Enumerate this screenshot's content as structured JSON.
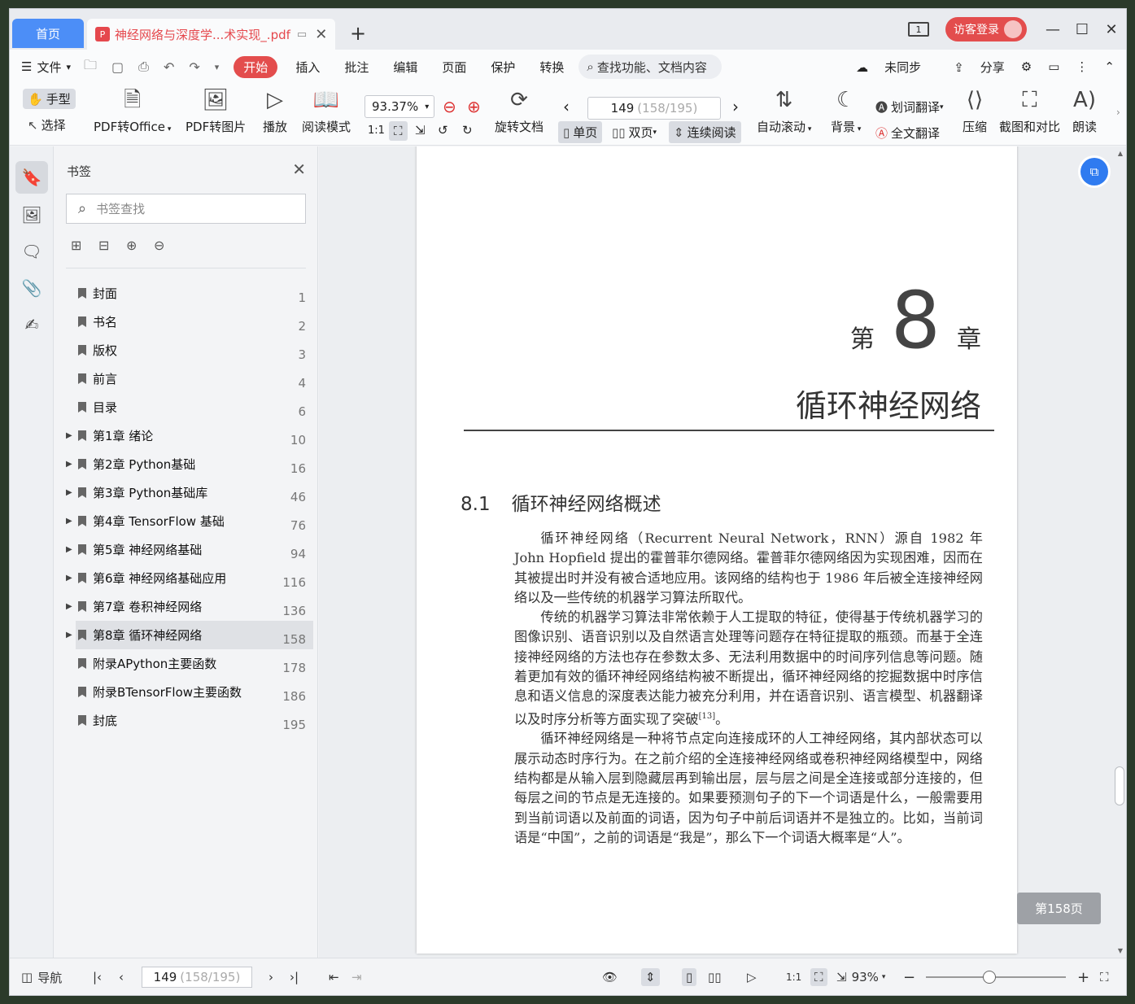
{
  "tabs": {
    "home": "首页",
    "doc_title": "神经网络与深度学...术实现_.pdf",
    "pdf_badge": "P",
    "add": "+"
  },
  "window": {
    "page_count_icon": "1",
    "guest_login": "访客登录",
    "minimize": "—",
    "maximize": "☐",
    "close": "✕"
  },
  "menu": {
    "file": "文件",
    "items": [
      "开始",
      "插入",
      "批注",
      "编辑",
      "页面",
      "保护",
      "转换"
    ],
    "search": "查找功能、文档内容",
    "sync": "未同步",
    "share": "分享"
  },
  "ribbon": {
    "hand": "手型",
    "select": "选择",
    "pdf_office": "PDF转Office",
    "pdf_image": "PDF转图片",
    "play": "播放",
    "read_mode": "阅读模式",
    "zoom": "93.37%",
    "rotate": "旋转文档",
    "page_current": "149",
    "page_total": "(158/195)",
    "single": "单页",
    "double": "双页",
    "continuous": "连续阅读",
    "auto_scroll": "自动滚动",
    "background": "背景",
    "word_translate": "划词翻译",
    "full_translate": "全文翻译",
    "compress": "压缩",
    "screenshot_compare": "截图和对比",
    "read_aloud": "朗读"
  },
  "bookmarks": {
    "title": "书签",
    "search_placeholder": "书签查找",
    "items": [
      {
        "label": "封面",
        "page": "1"
      },
      {
        "label": "书名",
        "page": "2"
      },
      {
        "label": "版权",
        "page": "3"
      },
      {
        "label": "前言",
        "page": "4"
      },
      {
        "label": "目录",
        "page": "6"
      },
      {
        "label": "第1章 绪论",
        "page": "10"
      },
      {
        "label": "第2章 Python基础",
        "page": "16"
      },
      {
        "label": "第3章 Python基础库",
        "page": "46"
      },
      {
        "label": "第4章 TensorFlow 基础",
        "page": "76"
      },
      {
        "label": "第5章 神经网络基础",
        "page": "94"
      },
      {
        "label": "第6章 神经网络基础应用",
        "page": "116"
      },
      {
        "label": "第7章 卷积神经网络",
        "page": "136"
      },
      {
        "label": "第8章 循环神经网络",
        "page": "158"
      },
      {
        "label": "附录APython主要函数",
        "page": "178"
      },
      {
        "label": "附录BTensorFlow主要函数",
        "page": "186"
      },
      {
        "label": "封底",
        "page": "195"
      }
    ]
  },
  "page": {
    "chapter_prefix": "第",
    "chapter_number": "8",
    "chapter_suffix": "章",
    "chapter_title": "循环神经网络",
    "section_number": "8.1",
    "section_title": "循环神经网络概述",
    "para1": "循环神经网络（Recurrent Neural Network，RNN）源自 1982 年 John Hopfield 提出的霍普菲尔德网络。霍普菲尔德网络因为实现困难，因而在其被提出时并没有被合适地应用。该网络的结构也于 1986 年后被全连接神经网络以及一些传统的机器学习算法所取代。",
    "para2": "传统的机器学习算法非常依赖于人工提取的特征，使得基于传统机器学习的图像识别、语音识别以及自然语言处理等问题存在特征提取的瓶颈。而基于全连接神经网络的方法也存在参数太多、无法利用数据中的时间序列信息等问题。随着更加有效的循环神经网络结构被不断提出，循环神经网络的挖掘数据中时序信息和语义信息的深度表达能力被充分利用，并在语音识别、语言模型、机器翻译以及时序分析等方面实现了突破",
    "para2_cite": "[13]",
    "para2_end": "。",
    "para3": "循环神经网络是一种将节点定向连接成环的人工神经网络，其内部状态可以展示动态时序行为。在之前介绍的全连接神经网络或卷积神经网络模型中，网络结构都是从输入层到隐藏层再到输出层，层与层之间是全连接或部分连接的，但每层之间的节点是无连接的。如果要预测句子的下一个词语是什么，一般需要用到当前词语以及前面的词语，因为句子中前后词语并不是独立的。比如，当前词语是“中国”，之前的词语是“我是”，那么下一个词语大概率是“人”。",
    "badge": "第158页"
  },
  "status": {
    "nav": "导航",
    "page_current": "149",
    "page_total": "(158/195)",
    "zoom": "93%"
  }
}
